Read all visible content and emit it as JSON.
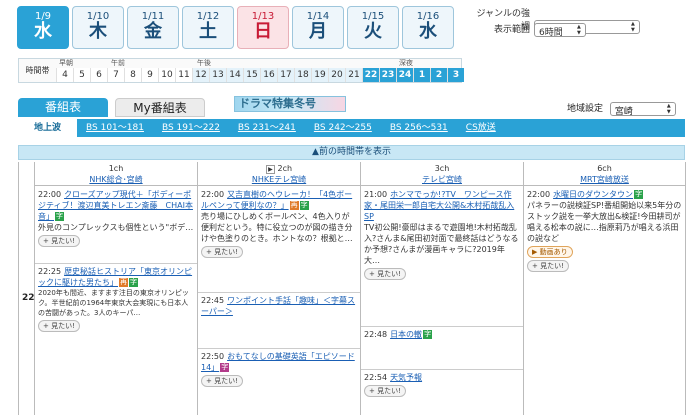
{
  "days": [
    {
      "date": "1/9",
      "wd": "水",
      "state": "active"
    },
    {
      "date": "1/10",
      "wd": "木",
      "state": ""
    },
    {
      "date": "1/11",
      "wd": "金",
      "state": ""
    },
    {
      "date": "1/12",
      "wd": "土",
      "state": ""
    },
    {
      "date": "1/13",
      "wd": "日",
      "state": "sun"
    },
    {
      "date": "1/14",
      "wd": "月",
      "state": ""
    },
    {
      "date": "1/15",
      "wd": "火",
      "state": ""
    },
    {
      "date": "1/16",
      "wd": "水",
      "state": ""
    }
  ],
  "genre": {
    "label": "ジャンルの強調",
    "value": "強調なし"
  },
  "range": {
    "label": "表示範囲",
    "value": "6時間"
  },
  "timebar": {
    "label": "時間帯",
    "periods": [
      "早朝",
      "午前",
      "午後",
      "深夜"
    ],
    "hours": [
      "4",
      "5",
      "6",
      "7",
      "8",
      "9",
      "10",
      "11",
      "12",
      "13",
      "14",
      "15",
      "16",
      "17",
      "18",
      "19",
      "20",
      "21",
      "22",
      "23",
      "24",
      "1",
      "2",
      "3"
    ]
  },
  "tabs": {
    "main": "番組表",
    "my": "My番組表"
  },
  "banner": "ドラマ特集冬号",
  "region": {
    "label": "地域設定",
    "value": "宮崎"
  },
  "nav": [
    "地上波",
    "BS 101～181",
    "BS 191～222",
    "BS 231～241",
    "BS 242～255",
    "BS 256～531",
    "CS放送"
  ],
  "prev": "▲前の時間帯を表示",
  "rowlabel": "22",
  "mitai": "見たい!",
  "video": "動画あり",
  "channels": [
    {
      "num": "1ch",
      "name": "NHK総合･宮崎",
      "programs": [
        {
          "time": "22:00",
          "title": "クローズアップ現代＋「ボディーポジティブ！渡辺直美トレエン斎藤　CHAI本音」",
          "desc": "外見のコンプレックスも個性という\"ボデ…"
        },
        {
          "time": "22:25",
          "title": "歴史秘話ヒストリア「東京オリンピックに駆けた男たち」",
          "desc": "2020年も間近、ますます注目の東京オリンピック。半世紀前の1964年東京大会実現にも日本人の苦闘があった。3人のキーパ…"
        }
      ]
    },
    {
      "num": "2ch",
      "name": "NHKEテレ宮崎",
      "programs": [
        {
          "time": "22:00",
          "title": "又吉直樹のヘウレーカ！「4色ボールペンって便利なの？」",
          "desc": "売り場にひしめくボールペン、4色入りが便利だという。特に役立つのが図の描き分けや色塗りのとき。ホントなの？根拠と…"
        },
        {
          "time": "22:45",
          "title": "ワンポイント手話「趣味」＜字幕スーパー＞",
          "desc": ""
        },
        {
          "time": "22:50",
          "title": "おもてなしの基礎英語「エピソード14」",
          "desc": ""
        }
      ]
    },
    {
      "num": "3ch",
      "name": "テレビ宮崎",
      "programs": [
        {
          "time": "21:00",
          "title": "ホンマでっか!?TV　ワンピース作家・尾田栄一郎自宅大公開&木村拓哉乱入SP",
          "desc": "TV初公開!豪邸はまるで遊園地!木村拓哉乱入?さんま&尾田初対面で最終話はどうなるか予想?さんまが漫画キャラに?2019年大…"
        },
        {
          "time": "22:48",
          "title": "日本の轍",
          "desc": ""
        },
        {
          "time": "22:54",
          "title": "天気予報",
          "desc": ""
        }
      ]
    },
    {
      "num": "6ch",
      "name": "MRT宮崎放送",
      "programs": [
        {
          "time": "22:00",
          "title": "水曜日のダウンタウン",
          "desc": "パネラーの説検証SP!番組開始以来5年分のストック説を一挙大放出&検証!今田耕司が唱える松本の説に…指原莉乃が唱える浜田の説など"
        }
      ]
    }
  ]
}
